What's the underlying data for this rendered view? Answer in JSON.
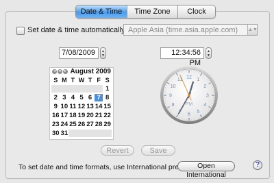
{
  "tabs": [
    {
      "label": "Date & Time",
      "active": true
    },
    {
      "label": "Time Zone",
      "active": false
    },
    {
      "label": "Clock",
      "active": false
    }
  ],
  "auto": {
    "label": "Set date & time automatically:",
    "checked": false,
    "server": "Apple Asia (time.asia.apple.com)"
  },
  "date_field": {
    "value": "7/08/2009"
  },
  "time_field": {
    "value": "12:34:56 PM"
  },
  "calendar": {
    "month_title": "August 2009",
    "weekdays": [
      "S",
      "M",
      "T",
      "W",
      "T",
      "F",
      "S"
    ],
    "weeks": [
      [
        "",
        "",
        "",
        "",
        "",
        "",
        "1"
      ],
      [
        "2",
        "3",
        "4",
        "5",
        "6",
        "7",
        "8"
      ],
      [
        "9",
        "10",
        "11",
        "12",
        "13",
        "14",
        "15"
      ],
      [
        "16",
        "17",
        "18",
        "19",
        "20",
        "21",
        "22"
      ],
      [
        "23",
        "24",
        "25",
        "26",
        "27",
        "28",
        "29"
      ],
      [
        "30",
        "31",
        "",
        "",
        "",
        "",
        ""
      ]
    ],
    "selected_day": "7"
  },
  "clock": {
    "numbers": [
      "12",
      "1",
      "2",
      "3",
      "4",
      "5",
      "6",
      "7",
      "8",
      "9",
      "10",
      "11"
    ],
    "ampm": "PM",
    "hour": 12,
    "minute": 34,
    "second": 56
  },
  "actions": {
    "revert": "Revert",
    "save": "Save"
  },
  "footer": {
    "text": "To set date and time formats, use International preferences.",
    "open_button": "Open International",
    "help": "?"
  },
  "colors": {
    "accent": "#4a8fdc",
    "second_hand": "#e08a2e",
    "clock_numbers": "#6a8fb8"
  }
}
